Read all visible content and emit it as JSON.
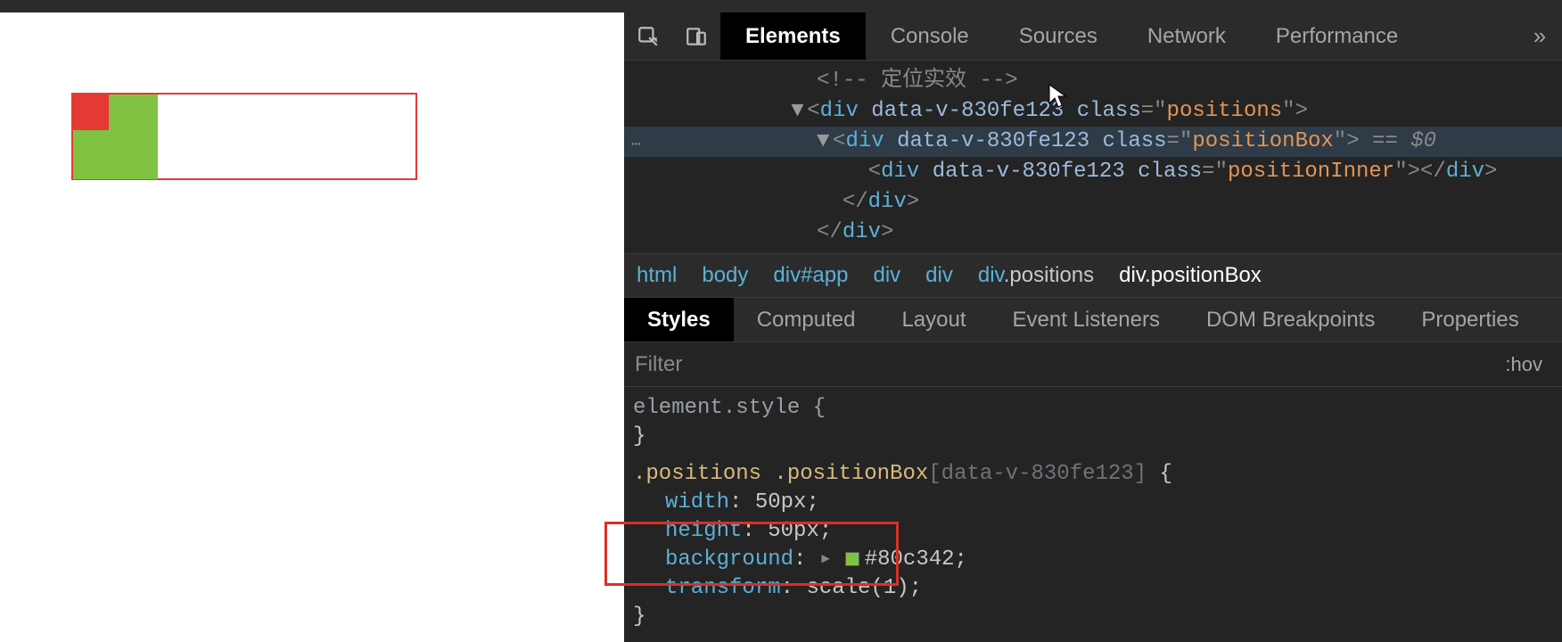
{
  "tabs": {
    "elements": "Elements",
    "console": "Console",
    "sources": "Sources",
    "network": "Network",
    "performance": "Performance",
    "more": "»"
  },
  "dom": {
    "comment": "<!-- 定位实效 -->",
    "l1_open": "<div data-v-830fe123 class=\"",
    "l1_cls": "positions",
    "l1_close": "\">",
    "l2_open": "<div data-v-830fe123 class=\"",
    "l2_cls": "positionBox",
    "l2_close": "\">",
    "l2_sel": " == $0",
    "l3_open": "<div data-v-830fe123 class=\"",
    "l3_cls": "positionInner",
    "l3_close": "\"></div>",
    "cdiv": "</div>"
  },
  "crumbs": {
    "c0": "html",
    "c1": "body",
    "c2": "div#app",
    "c3": "div",
    "c4": "div",
    "c5_a": "div",
    "c5_b": ".positions",
    "c6_a": "div",
    "c6_b": ".positionBox"
  },
  "subtabs": {
    "styles": "Styles",
    "computed": "Computed",
    "layout": "Layout",
    "listeners": "Event Listeners",
    "dom_bp": "DOM Breakpoints",
    "properties": "Properties"
  },
  "filter": {
    "placeholder": "Filter",
    "hov": ":hov"
  },
  "styles": {
    "elStyle": "element.style {",
    "close": "}",
    "rule_sel_a": ".positions .positionBox",
    "rule_sel_b": "[data-v-830fe123]",
    "open_brace": " {",
    "p1n": "width",
    "p1v": "50px",
    "p2n": "height",
    "p2v": "50px",
    "p3n": "background",
    "p3v": "#80c342",
    "p4n": "transform",
    "p4v": "scale(1)",
    "semi": ";"
  },
  "colors": {
    "swatch": "#80c342"
  }
}
